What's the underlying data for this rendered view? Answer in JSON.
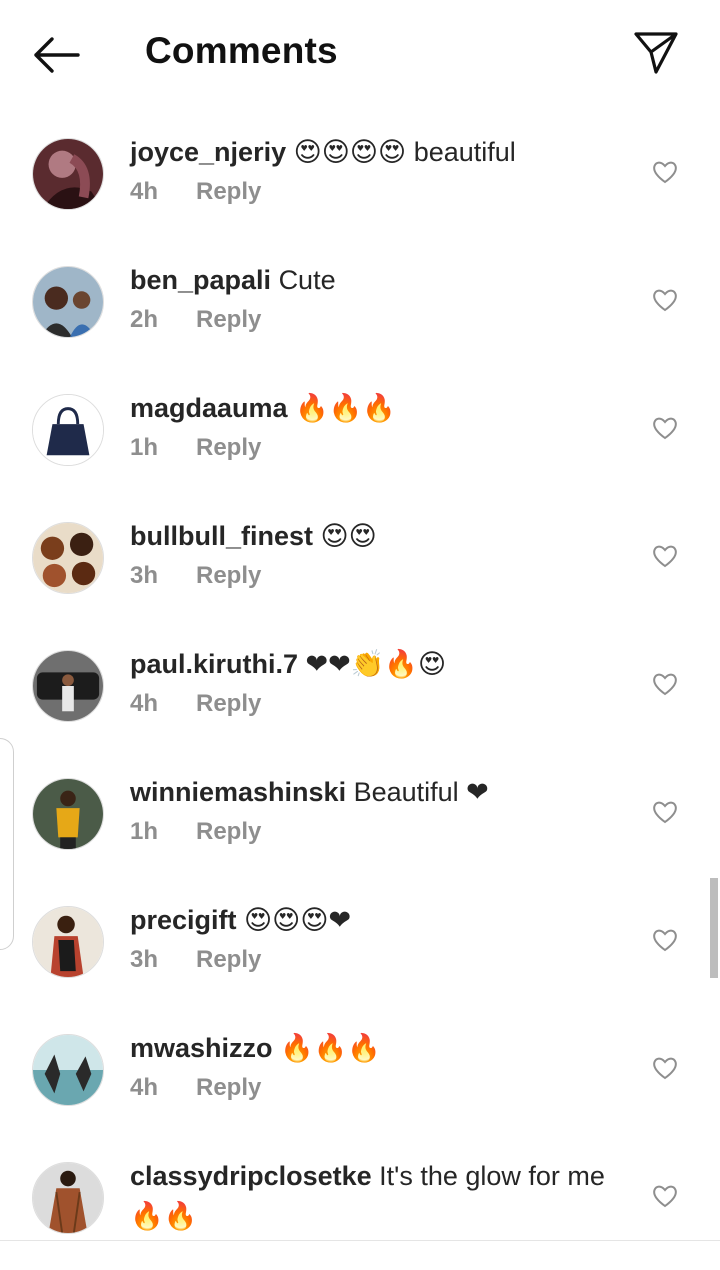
{
  "header": {
    "title": "Comments",
    "back_icon": "arrow-left-icon",
    "share_icon": "paper-plane-icon"
  },
  "comments": [
    {
      "username": "joyce_njeriy",
      "text": "😍😍😍😍 beautiful",
      "time": "4h",
      "reply": "Reply"
    },
    {
      "username": "ben_papali",
      "text": "Cute",
      "time": "2h",
      "reply": "Reply"
    },
    {
      "username": "magdaauma",
      "text": "🔥🔥🔥",
      "time": "1h",
      "reply": "Reply"
    },
    {
      "username": "bullbull_finest",
      "text": "😍😍",
      "time": "3h",
      "reply": "Reply"
    },
    {
      "username": "paul.kiruthi.7",
      "text": "❤❤👏🔥😍",
      "time": "4h",
      "reply": "Reply"
    },
    {
      "username": "winniemashinski",
      "text": "Beautiful ❤",
      "time": "1h",
      "reply": "Reply"
    },
    {
      "username": "precigift",
      "text": "😍😍😍❤",
      "time": "3h",
      "reply": "Reply"
    },
    {
      "username": "mwashizzo",
      "text": "🔥🔥🔥",
      "time": "4h",
      "reply": "Reply"
    },
    {
      "username": "classydripclosetke",
      "text": "It's the glow for me 🔥🔥",
      "time": "",
      "reply": ""
    }
  ],
  "colors": {
    "text": "#262626",
    "muted": "#8e8e8e",
    "heart_red": "#e0245e"
  }
}
